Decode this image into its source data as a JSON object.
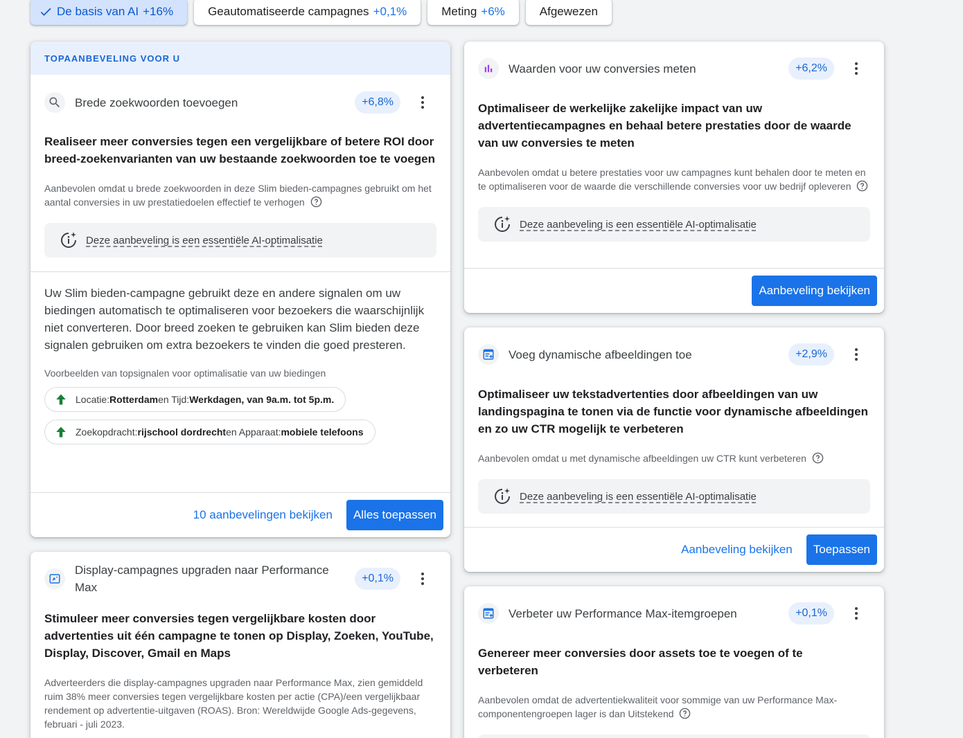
{
  "chips": [
    {
      "label": "De basis van AI",
      "delta": "+16%",
      "selected": true
    },
    {
      "label": "Geautomatiseerde campagnes",
      "delta": "+0,1%"
    },
    {
      "label": "Meting",
      "delta": "+6%"
    },
    {
      "label": "Afgewezen",
      "delta": ""
    }
  ],
  "colors": {
    "accent": "#1a73e8",
    "banner": "#e8f0fe",
    "up_arrow": "#188038",
    "chart_icon": "#a142f4"
  },
  "ai_note": "Deze aanbeveling is een essentiële AI-optimalisatie",
  "top_card": {
    "banner": "TOPAANBEVELING VOOR U",
    "icon": "search-icon",
    "title": "Brede zoekwoorden toevoegen",
    "delta": "+6,8%",
    "headline": "Realiseer meer conversies tegen een vergelijkbare of betere ROI door breed-zoekenvarianten van uw bestaande zoekwoorden toe te voegen",
    "desc": "Aanbevolen omdat u brede zoekwoorden in deze Slim bieden-campagnes gebruikt om het aantal conversies in uw prestatiedoelen effectief te verhogen",
    "body": "Uw Slim bieden-campagne gebruikt deze en andere signalen om uw biedingen automatisch te optimaliseren voor bezoekers die waarschijnlijk niet converteren. Door breed zoeken te gebruiken kan Slim bieden deze signalen gebruiken om extra bezoekers te vinden die goed presteren.",
    "signals_title": "Voorbeelden van topsignalen voor optimalisatie van uw biedingen",
    "signals": [
      {
        "k1": "Locatie: ",
        "v1": "Rotterdam",
        "mid": " en Tijd: ",
        "v2": "Werkdagen, van 9a.m. tot 5p.m."
      },
      {
        "k1": "Zoekopdracht: ",
        "v1": "rijschool dordrecht",
        "mid": " en Apparaat: ",
        "v2": "mobiele telefoons"
      }
    ],
    "link": "10 aanbevelingen bekijken",
    "apply_all": "Alles toepassen"
  },
  "display_card": {
    "icon": "performance-max-icon",
    "title": "Display-campagnes upgraden naar Performance Max",
    "delta": "+0,1%",
    "headline": "Stimuleer meer conversies tegen vergelijkbare kosten door advertenties uit één campagne te tonen op Display, Zoeken, YouTube, Display, Discover, Gmail en Maps",
    "desc": "Adverteerders die display-campagnes upgraden naar Performance Max, zien gemiddeld ruim 38% meer conversies tegen vergelijkbare kosten per actie (CPA)/een vergelijkbaar rendement op advertentie-uitgaven (ROAS). Bron: Wereldwijde Google Ads-gegevens, februari - juli 2023."
  },
  "value_card": {
    "icon": "bar-chart-icon",
    "title": "Waarden voor uw conversies meten",
    "delta": "+6,2%",
    "headline": "Optimaliseer de werkelijke zakelijke impact van uw advertentiecampagnes en behaal betere prestaties door de waarde van uw conversies te meten",
    "desc": "Aanbevolen omdat u betere prestaties voor uw campagnes kunt behalen door te meten en te optimaliseren voor de waarde die verschillende conversies voor uw bedrijf opleveren",
    "button": "Aanbeveling bekijken"
  },
  "images_card": {
    "icon": "dynamic-images-icon",
    "title": "Voeg dynamische afbeeldingen toe",
    "delta": "+2,9%",
    "headline": "Optimaliseer uw tekstadvertenties door afbeeldingen van uw landingspagina te tonen via de functie voor dynamische afbeeldingen en zo uw CTR mogelijk te verbeteren",
    "desc": "Aanbevolen omdat u met dynamische afbeeldingen uw CTR kunt verbeteren",
    "link": "Aanbeveling bekijken",
    "button": "Toepassen"
  },
  "pmax_card": {
    "icon": "asset-group-icon",
    "title": "Verbeter uw Performance Max-itemgroepen",
    "delta": "+0,1%",
    "headline": "Genereer meer conversies door assets toe te voegen of te verbeteren",
    "desc": "Aanbevolen omdat de advertentiekwaliteit voor sommige van uw Performance Max-componentengroepen lager is dan Uitstekend"
  }
}
